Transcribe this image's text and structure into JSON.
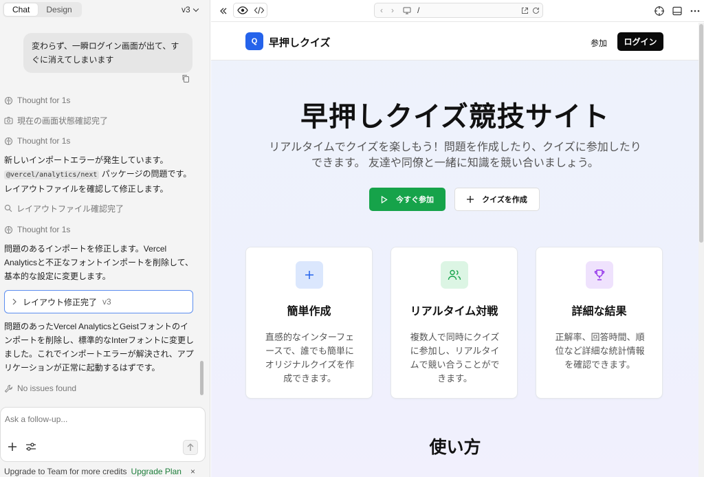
{
  "left": {
    "tabs": [
      {
        "label": "Chat"
      },
      {
        "label": "Design"
      }
    ],
    "version": "v3",
    "user_message": "変わらず、一瞬ログイン画面が出て、すぐに消えてしまいます",
    "steps": {
      "thought1": "Thought for 1s",
      "screen_check": "現在の画面状態確認完了",
      "thought2": "Thought for 1s",
      "layout_check": "レイアウトファイル確認完了",
      "thought3": "Thought for 1s",
      "no_issues": "No issues found"
    },
    "msg1": {
      "before": "新しいインポートエラーが発生しています。",
      "code": "@vercel/analytics/next",
      "after": " パッケージの問題です。レイアウトファイルを確認して修正します。"
    },
    "msg2": "問題のあるインポートを修正します。Vercel Analyticsと不正なフォントインポートを削除して、基本的な設定に変更します。",
    "result": {
      "label": "レイアウト修正完了",
      "version": "v3"
    },
    "msg3": "問題のあったVercel AnalyticsとGeistフォントのインポートを削除し、標準的なInterフォントに変更しました。これでインポートエラーが解決され、アプリケーションが正常に起動するはずです。",
    "composer": {
      "placeholder": "Ask a follow-up..."
    },
    "upgrade": {
      "text": "Upgrade to Team for more credits",
      "link": "Upgrade Plan",
      "close": "×"
    }
  },
  "toolbar": {
    "url": "/"
  },
  "site": {
    "logo_letter": "Q",
    "brand": "早押しクイズ",
    "nav_join": "参加",
    "nav_login": "ログイン",
    "hero_title": "早押しクイズ競技サイト",
    "hero_subtitle": "リアルタイムでクイズを楽しもう！問題を作成したり、クイズに参加したりできます。 友達や同僚と一緒に知識を競い合いましょう。",
    "btn_join": "今すぐ参加",
    "btn_create": "クイズを作成",
    "features": [
      {
        "title": "簡単作成",
        "desc": "直感的なインターフェースで、誰でも簡単にオリジナルクイズを作成できます。",
        "icon": "plus-icon",
        "color": "#2563eb",
        "bg": "#dbe7fd"
      },
      {
        "title": "リアルタイム対戦",
        "desc": "複数人で同時にクイズに参加し、リアルタイムで競い合うことができます。",
        "icon": "users-icon",
        "color": "#16a34a",
        "bg": "#dcf5e4"
      },
      {
        "title": "詳細な結果",
        "desc": "正解率、回答時間、順位など詳細な統計情報を確認できます。",
        "icon": "trophy-icon",
        "color": "#9333ea",
        "bg": "#efe2fd"
      }
    ],
    "howto_title": "使い方"
  }
}
